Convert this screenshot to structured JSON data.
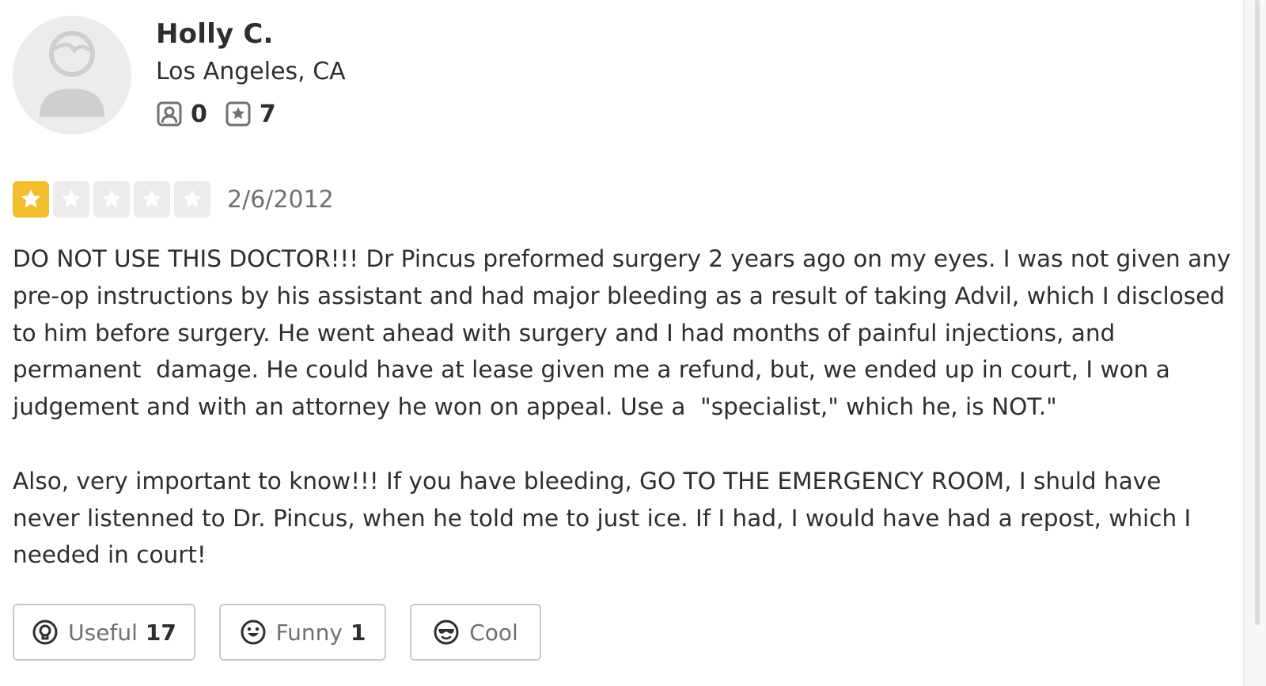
{
  "user": {
    "name": "Holly C.",
    "location": "Los Angeles, CA",
    "friends_count": "0",
    "reviews_count": "7",
    "friends_icon": "friends-icon",
    "reviews_icon": "review-star-icon"
  },
  "review": {
    "rating": 1,
    "max_rating": 5,
    "date": "2/6/2012",
    "paragraphs": [
      "DO NOT USE THIS DOCTOR!!! Dr Pincus preformed surgery 2 years ago on my eyes. I was not given any pre-op instructions by his assistant and had major bleeding as a result of taking Advil, which I disclosed to him before surgery. He went ahead with surgery and I had months of painful injections, and permanent  damage. He could have at lease given me a refund, but, we ended up in court, I won a judgement and with an attorney he won on appeal. Use a  \"specialist,\" which he, is NOT.\"",
      "Also, very important to know!!! If you have bleeding, GO TO THE EMERGENCY ROOM, I shuld have never listenned to Dr. Pincus, when he told me to just ice. If I had, I would have had a repost, which I needed in court!"
    ]
  },
  "reactions": {
    "useful": {
      "label": "Useful",
      "count": "17",
      "icon": "lightbulb-icon"
    },
    "funny": {
      "label": "Funny",
      "count": "1",
      "icon": "smile-icon"
    },
    "cool": {
      "label": "Cool",
      "count": "",
      "icon": "sunglasses-icon"
    }
  },
  "colors": {
    "star_filled": "#f2bd2f",
    "star_empty": "#ececec",
    "text_primary": "#2d2e2f",
    "text_secondary": "#6e7072",
    "button_border": "#c9c9c9"
  }
}
